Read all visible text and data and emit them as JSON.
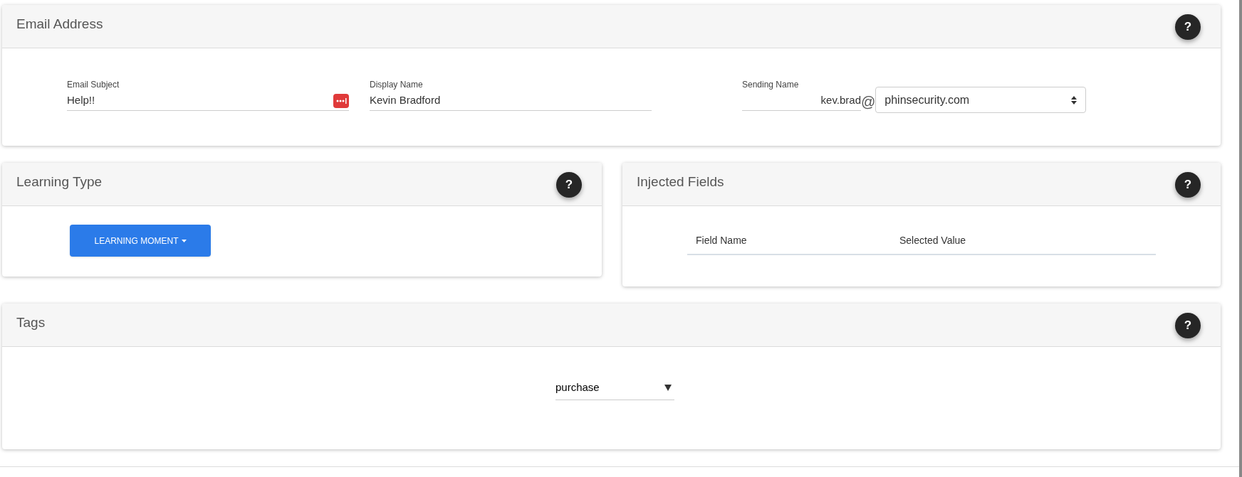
{
  "email_address": {
    "title": "Email Address",
    "help": "?",
    "subject": {
      "label": "Email Subject",
      "value": "Help!!"
    },
    "display_name": {
      "label": "Display Name",
      "value": "Kevin Bradford"
    },
    "sending_name": {
      "label": "Sending Name",
      "value": "kev.brad",
      "at": "@",
      "domain": "phinsecurity.com"
    }
  },
  "learning_type": {
    "title": "Learning Type",
    "help": "?",
    "button": "LEARNING MOMENT"
  },
  "injected_fields": {
    "title": "Injected Fields",
    "help": "?",
    "columns": [
      "Field Name",
      "Selected Value"
    ]
  },
  "tags": {
    "title": "Tags",
    "help": "?",
    "value": "purchase"
  }
}
